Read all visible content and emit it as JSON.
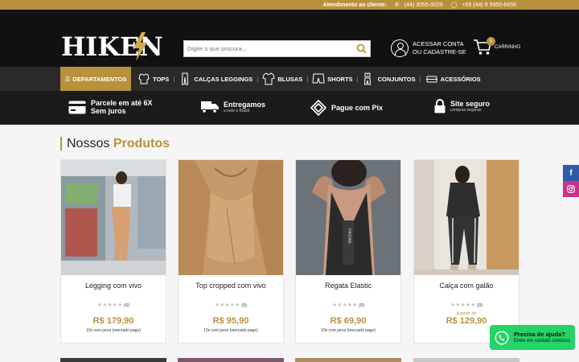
{
  "topbar": {
    "label": "Atendimento ao cliente:",
    "phone": "(44) 3055-3029",
    "whatsapp": "+55 (44) 9 9950-6655"
  },
  "header": {
    "logo": "HIKENA",
    "search_placeholder": "Digite o que procura...",
    "account_line1": "ACESSAR CONTA",
    "account_line2": "OU CADASTRE-SE",
    "cart_label": "CARRINHO",
    "cart_count": "0"
  },
  "nav": {
    "departments": "DEPARTAMENTOS",
    "items": [
      {
        "label": "TOPS",
        "icon": "top-icon"
      },
      {
        "label": "CALÇAS LEGGINGS",
        "icon": "leggings-icon"
      },
      {
        "label": "BLUSAS",
        "icon": "shirt-icon"
      },
      {
        "label": "SHORTS",
        "icon": "shorts-icon"
      },
      {
        "label": "CONJUNTOS",
        "icon": "sets-icon"
      },
      {
        "label": "ACESSÓRIOS",
        "icon": "accessories-icon"
      }
    ]
  },
  "features": [
    {
      "title": "Parcele em até 6X",
      "title2": "Sem juros",
      "sub": "",
      "icon": "card-icon"
    },
    {
      "title": "Entregamos",
      "title2": "",
      "sub": "a todo o Brasil",
      "icon": "truck-icon"
    },
    {
      "title": "Pague com Pix",
      "title2": "",
      "sub": "",
      "icon": "pix-icon"
    },
    {
      "title": "Site seguro",
      "title2": "",
      "sub": "compras seguras",
      "icon": "lock-icon"
    }
  ],
  "section": {
    "title_a": "Nossos",
    "title_b": "Produtos"
  },
  "products": [
    {
      "name": "Legging com vivo",
      "reviews": "(0)",
      "from": "",
      "price": "R$ 179,90",
      "installments": "10x com juros (mercado pago)"
    },
    {
      "name": "Top cropped com vivo",
      "reviews": "(0)",
      "from": "",
      "price": "R$ 95,90",
      "installments": "10x com juros (mercado pago)"
    },
    {
      "name": "Regata Elastic",
      "reviews": "(0)",
      "from": "",
      "price": "R$ 69,90",
      "installments": "10x com juros (mercado pago)"
    },
    {
      "name": "Calça com galão",
      "reviews": "(0)",
      "from": "A partir de",
      "price": "R$ 129,90",
      "installments": ""
    }
  ],
  "stars": "★★★★★",
  "chat": {
    "title": "Precisa de ajuda?",
    "sub": "Entre em contato conosco"
  },
  "colors": {
    "brand": "#b8913d",
    "dark": "#111111",
    "whatsapp": "#25d366"
  }
}
